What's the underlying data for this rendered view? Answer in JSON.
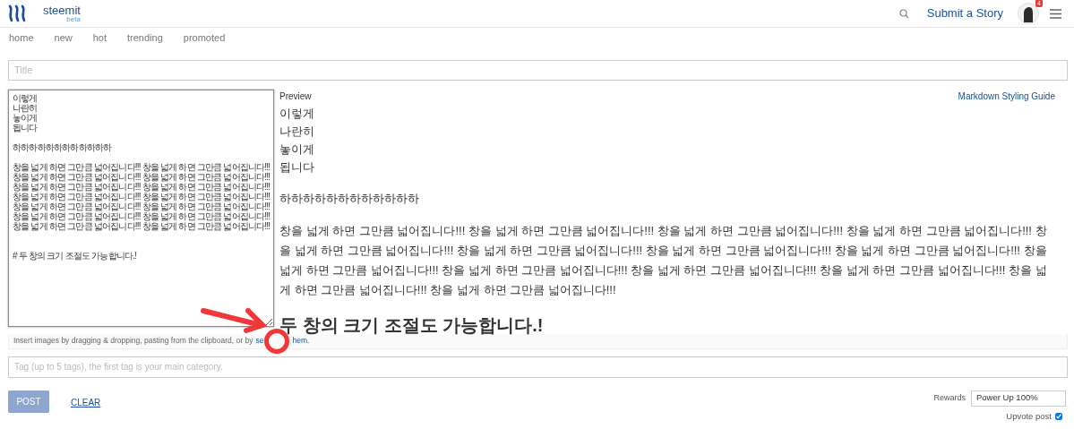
{
  "header": {
    "logo_text": "steemit",
    "logo_badge": "beta",
    "submit_link": "Submit a Story",
    "notification_count": "4"
  },
  "nav": [
    {
      "label": "home"
    },
    {
      "label": "new"
    },
    {
      "label": "hot"
    },
    {
      "label": "trending"
    },
    {
      "label": "promoted"
    }
  ],
  "title_field": {
    "placeholder": "Title"
  },
  "editor": {
    "value": "이렇게\n나란히\n놓이게\n됩니다\n\n하하하하하하하하하하하하\n\n창을 넓게 하면 그만큼 넓어집니다!!! 창을 넓게 하면 그만큼 넓어집니다!!!\n창을 넓게 하면 그만큼 넓어집니다!!! 창을 넓게 하면 그만큼 넓어집니다!!!\n창을 넓게 하면 그만큼 넓어집니다!!! 창을 넓게 하면 그만큼 넓어집니다!!!\n창을 넓게 하면 그만큼 넓어집니다!!! 창을 넓게 하면 그만큼 넓어집니다!!!\n창을 넓게 하면 그만큼 넓어집니다!!! 창을 넓게 하면 그만큼 넓어집니다!!!\n창을 넓게 하면 그만큼 넓어집니다!!! 창을 넓게 하면 그만큼 넓어집니다!!!\n창을 넓게 하면 그만큼 넓어집니다!!! 창을 넓게 하면 그만큼 넓어집니다!!!\n\n\n# 두 창의 크기 조절도 가능합니다.!"
  },
  "preview": {
    "label": "Preview",
    "guide_link": "Markdown Styling Guide",
    "blocks": [
      {
        "kind": "lines",
        "lines": [
          "이렇게",
          "나란히",
          "놓이게",
          "됩니다"
        ]
      },
      {
        "kind": "paragraph",
        "text": "하하하하하하하하하하하하"
      },
      {
        "kind": "paragraph",
        "text": "창을 넓게 하면 그만큼 넓어집니다!!! 창을 넓게 하면 그만큼 넓어집니다!!! 창을 넓게 하면 그만큼 넓어집니다!!! 창을 넓게 하면 그만큼 넓어집니다!!! 창을 넓게 하면 그만큼 넓어집니다!!! 창을 넓게 하면 그만큼 넓어집니다!!! 창을 넓게 하면 그만큼 넓어집니다!!! 창을 넓게 하면 그만큼 넓어집니다!!! 창을 넓게 하면 그만큼 넓어집니다!!! 창을 넓게 하면 그만큼 넓어집니다!!! 창을 넓게 하면 그만큼 넓어집니다!!! 창을 넓게 하면 그만큼 넓어집니다!!! 창을 넓게 하면 그만큼 넓어집니다!!! 창을 넓게 하면 그만큼 넓어집니다!!!"
      },
      {
        "kind": "heading",
        "text": "두 창의 크기 조절도 가능합니다.!"
      }
    ]
  },
  "upload_hint": {
    "text": "Insert images by dragging & dropping, pasting from the clipboard, or by",
    "link_parts": [
      "se",
      "hem"
    ],
    "trailing": "."
  },
  "tags_field": {
    "placeholder": "Tag (up to 5 tags), the first tag is your main category."
  },
  "actions": {
    "post": {
      "label": "POST",
      "disabled": true
    },
    "clear": "CLEAR"
  },
  "rewards": {
    "label": "Rewards",
    "value": "Power Up 100%"
  },
  "upvote": {
    "label": "Upvote post",
    "checked": true
  }
}
